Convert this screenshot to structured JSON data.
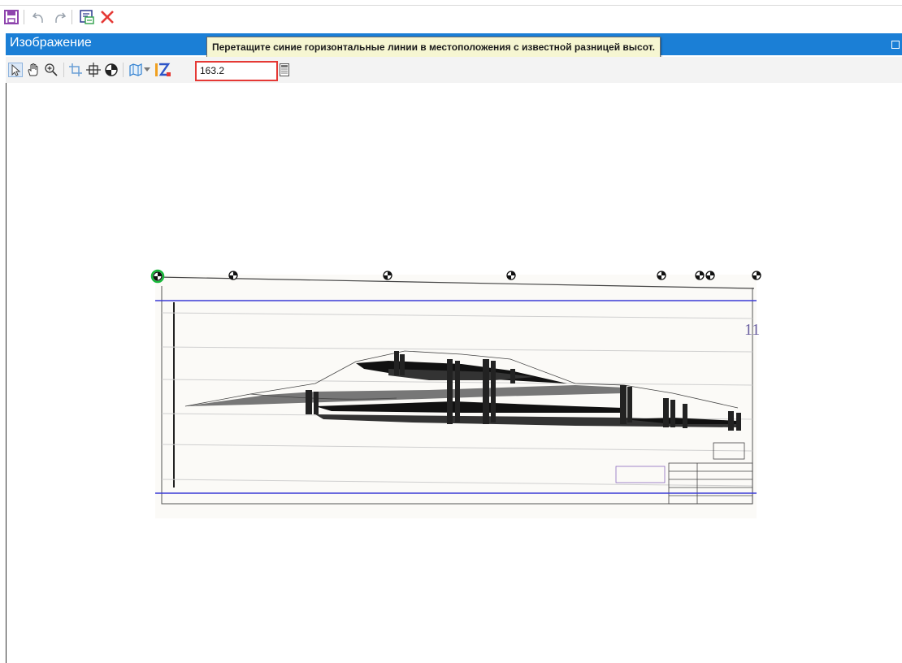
{
  "panel": {
    "title": "Изображение"
  },
  "tooltip": {
    "text": "Перетащите синие горизонтальные линии в местоположения с известной разницей высот."
  },
  "elevation": {
    "value": "163.2"
  },
  "drawing": {
    "sheet_number": "11"
  },
  "colors": {
    "titlebar": "#1b7fd6",
    "guide_lines": "#3a3ad6",
    "input_border": "#e53935",
    "delete_icon": "#e53935",
    "save_icon": "#8e44ad"
  },
  "icons": {
    "quick_access": [
      "save-icon",
      "undo-icon",
      "redo-icon",
      "georeference-icon",
      "delete-icon"
    ],
    "toolbar": [
      "select-arrow-icon",
      "pan-hand-icon",
      "zoom-in-icon",
      "crop-icon",
      "fit-extent-icon",
      "control-point-icon",
      "map-icon",
      "dropdown-arrow-icon",
      "elevation-z-icon",
      "calculator-icon"
    ]
  }
}
